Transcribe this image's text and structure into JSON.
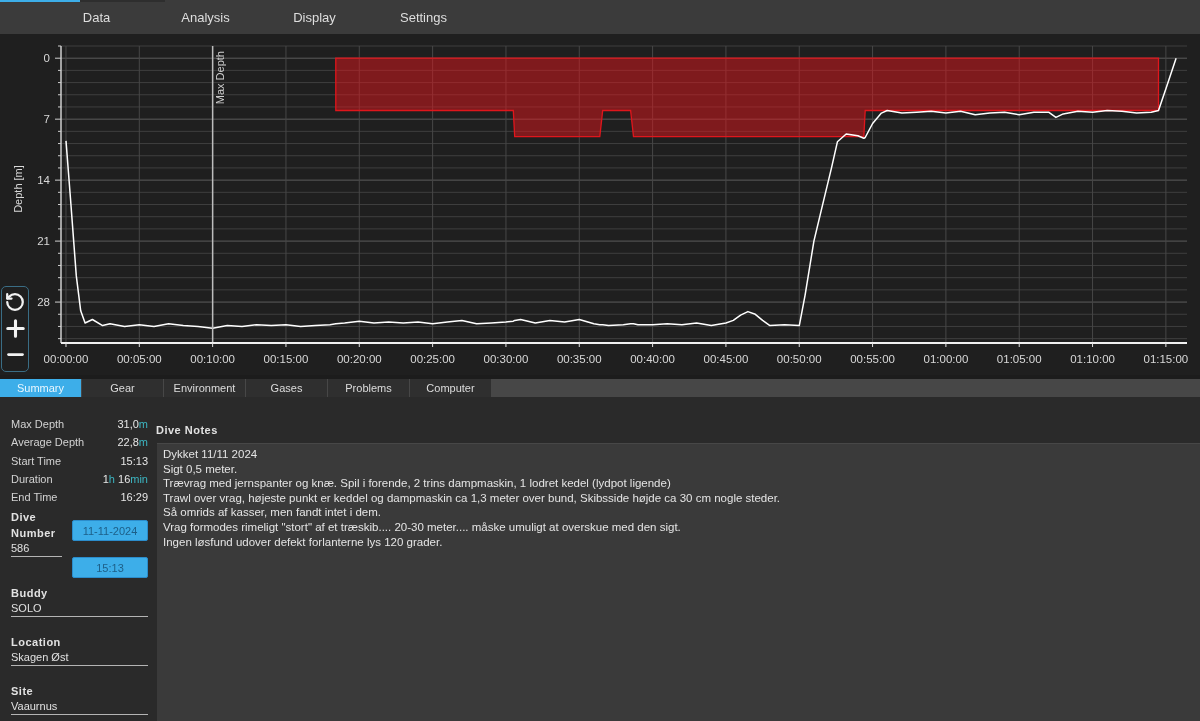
{
  "menu": [
    "Data",
    "Analysis",
    "Display",
    "Settings"
  ],
  "dive_profile": {
    "chart_data": {
      "type": "line",
      "ylabel": "Depth [m]",
      "grid": true,
      "x": [
        0,
        0.3,
        0.7,
        1,
        1.3,
        1.8,
        2.5,
        3,
        4,
        5,
        6,
        7,
        8,
        9,
        10,
        11,
        12,
        13,
        14,
        15,
        16,
        17,
        18,
        18.4,
        19,
        20,
        21,
        22,
        23,
        24,
        25,
        26,
        27,
        28,
        29,
        30,
        30.5,
        30.6,
        31,
        32,
        33,
        34,
        35,
        36,
        36.4,
        36.6,
        37,
        38,
        38.5,
        38.7,
        39,
        40,
        41,
        42,
        43,
        44,
        45,
        45.5,
        46,
        46.5,
        47,
        47.5,
        48,
        49,
        50,
        50.4,
        51,
        51.5,
        52.2,
        52.6,
        53.2,
        54,
        54.4,
        54.5,
        55,
        55.6,
        56,
        57,
        58,
        59,
        60,
        61,
        62,
        63,
        64,
        65,
        66,
        67,
        67.5,
        68,
        69,
        70,
        71,
        72,
        73,
        74,
        74.5,
        75,
        75.7
      ],
      "series": [
        {
          "type": "area",
          "color": "#e0161c",
          "values": [
            null,
            null,
            null,
            null,
            null,
            null,
            null,
            null,
            null,
            null,
            null,
            null,
            null,
            null,
            null,
            null,
            null,
            null,
            null,
            null,
            null,
            null,
            null,
            6,
            6,
            6,
            6,
            6,
            6,
            6,
            6,
            6,
            6,
            6,
            6,
            6,
            6,
            9,
            9,
            9,
            9,
            9,
            9,
            9,
            9,
            6,
            6,
            6,
            6,
            9,
            9,
            9,
            9,
            9,
            9,
            9,
            9,
            9,
            9,
            9,
            9,
            9,
            9,
            9,
            9,
            9,
            9,
            9,
            9,
            9,
            9,
            9,
            9,
            6,
            6,
            6,
            6,
            6,
            6,
            6,
            6,
            6,
            6,
            6,
            6,
            6,
            6,
            6,
            6,
            6,
            6,
            6,
            6,
            6,
            6,
            6,
            6,
            null,
            null
          ]
        },
        {
          "type": "line",
          "color": "#ffffff",
          "values": [
            9.5,
            16,
            25,
            29,
            30.4,
            30.0,
            30.7,
            30.5,
            30.8,
            30.6,
            30.8,
            30.5,
            30.7,
            30.8,
            31.0,
            30.7,
            30.8,
            30.6,
            30.7,
            30.6,
            30.8,
            30.7,
            30.6,
            30.5,
            30.4,
            30.2,
            30.4,
            30.3,
            30.4,
            30.3,
            30.5,
            30.3,
            30.1,
            30.5,
            30.4,
            30.3,
            30.2,
            30.1,
            30.0,
            30.4,
            30.1,
            30.3,
            30.0,
            30.5,
            30.6,
            30.6,
            30.7,
            30.6,
            30.5,
            30.5,
            30.6,
            30.6,
            30.5,
            30.6,
            30.4,
            30.7,
            30.4,
            30.1,
            29.5,
            29.1,
            29.4,
            30.1,
            30.7,
            30.6,
            30.7,
            27.2,
            21,
            17.5,
            12.6,
            9.6,
            8.7,
            8.9,
            9.2,
            9.1,
            7.5,
            6.3,
            6.0,
            6.3,
            6.2,
            6.1,
            6.3,
            6.1,
            6.5,
            6.3,
            6.2,
            6.5,
            6.2,
            6.2,
            6.8,
            6.4,
            6.1,
            6.2,
            6.0,
            6.1,
            6.3,
            6.2,
            6.0,
            3.5,
            0
          ]
        }
      ],
      "xlim": [
        -0.34,
        76.44
      ],
      "ylim": [
        32.7,
        -1.4
      ],
      "xticks": [
        {
          "value": 0,
          "label": "00:00:00"
        },
        {
          "value": 5,
          "label": "00:05:00"
        },
        {
          "value": 10,
          "label": "00:10:00"
        },
        {
          "value": 15,
          "label": "00:15:00"
        },
        {
          "value": 20,
          "label": "00:20:00"
        },
        {
          "value": 25,
          "label": "00:25:00"
        },
        {
          "value": 30,
          "label": "00:30:00"
        },
        {
          "value": 35,
          "label": "00:35:00"
        },
        {
          "value": 40,
          "label": "00:40:00"
        },
        {
          "value": 45,
          "label": "00:45:00"
        },
        {
          "value": 50,
          "label": "00:50:00"
        },
        {
          "value": 55,
          "label": "00:55:00"
        },
        {
          "value": 60,
          "label": "01:00:00"
        },
        {
          "value": 65,
          "label": "01:05:00"
        },
        {
          "value": 70,
          "label": "01:10:00"
        },
        {
          "value": 75,
          "label": "01:15:00"
        }
      ],
      "yticks": [
        0,
        7,
        14,
        21,
        28
      ],
      "ref_lines": [
        {
          "axis": "x",
          "value": 10,
          "label": "Max Depth"
        }
      ]
    }
  },
  "tabs": [
    {
      "label": "Summary",
      "selected": true
    },
    {
      "label": "Gear",
      "selected": false
    },
    {
      "label": "Environment",
      "selected": false
    },
    {
      "label": "Gases",
      "selected": false
    },
    {
      "label": "Problems",
      "selected": false
    },
    {
      "label": "Computer",
      "selected": false
    }
  ],
  "summary": {
    "stats": [
      {
        "label": "Max Depth",
        "value": [
          {
            "kind": "number",
            "text": "31,0"
          },
          {
            "kind": "unit",
            "text": "m"
          }
        ]
      },
      {
        "label": "Average Depth",
        "value": [
          {
            "kind": "number",
            "text": "22,8"
          },
          {
            "kind": "unit",
            "text": "m"
          }
        ]
      },
      {
        "label": "Start Time",
        "value": [
          {
            "kind": "number",
            "text": "15:13"
          }
        ]
      },
      {
        "label": "Duration",
        "value": [
          {
            "kind": "number",
            "text": "1"
          },
          {
            "kind": "unit",
            "text": "h"
          },
          {
            "kind": "number",
            "text": " 16"
          },
          {
            "kind": "unit",
            "text": "min"
          }
        ]
      },
      {
        "label": "End Time",
        "value": [
          {
            "kind": "number",
            "text": "16:29"
          }
        ]
      }
    ],
    "dive_number": {
      "label": "Dive Number",
      "value": "586"
    },
    "date": "11-11-2024",
    "time": "15:13",
    "fields": [
      {
        "label": "Buddy",
        "value": "SOLO"
      },
      {
        "label": "Location",
        "value": "Skagen Øst"
      },
      {
        "label": "Site",
        "value": "Vaaurnus"
      }
    ]
  },
  "notes": {
    "label": "Dive Notes",
    "text": "Dykket 11/11 2024\nSigt 0,5 meter.\nTrævrag med jernspanter og knæ. Spil i forende, 2 trins dampmaskin, 1 lodret kedel (lydpot ligende)\nTrawl over vrag, højeste punkt er keddel og dampmaskin ca 1,3 meter over bund, Skibsside højde ca 30 cm nogle steder.\nSå omrids af kasser, men fandt intet i dem.\nVrag formodes rimeligt \"stort\" af et træskib.... 20-30 meter.... måske umuligt at overskue med den sigt.\nIngen løsfund udover defekt forlanterne lys 120 grader."
  }
}
